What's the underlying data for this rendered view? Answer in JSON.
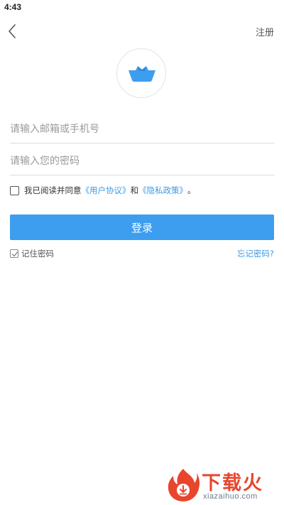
{
  "status_bar": {
    "time": "4:43"
  },
  "nav": {
    "back_icon": "chevron-left-icon",
    "register_label": "注册"
  },
  "logo": {
    "icon": "paper-boat-icon",
    "color": "#3d9ef0"
  },
  "form": {
    "account_placeholder": "请输入邮箱或手机号",
    "account_value": "",
    "password_placeholder": "请输入您的密码",
    "password_value": ""
  },
  "agreement": {
    "checked": false,
    "prefix": "我已阅读并同意",
    "user_agreement": "《用户协议》",
    "conjunction": "和",
    "privacy_policy": "《隐私政策》",
    "suffix": "。"
  },
  "login": {
    "label": "登录",
    "color": "#3d9ef0"
  },
  "remember": {
    "checked": true,
    "label": "记住密码"
  },
  "forgot": {
    "label": "忘记密码?"
  },
  "watermark": {
    "title": "下载火",
    "url": "xiazaihuo.com",
    "accent": "#e8452c"
  },
  "colors": {
    "link": "#3a9ae8",
    "divider": "#dcdcdc"
  }
}
